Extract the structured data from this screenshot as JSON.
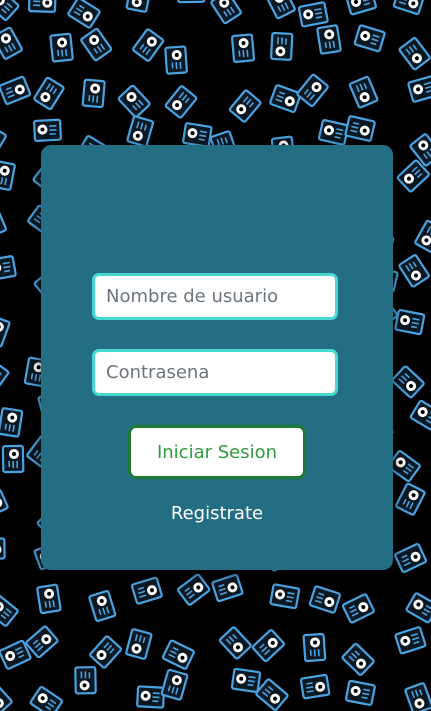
{
  "background": {
    "color": "#000000",
    "icon_color": "#4aa3e0",
    "icon_name": "id-card-eye-icon"
  },
  "login": {
    "title": "Iniciar Sesion",
    "username_placeholder": "Nombre de usuario",
    "password_placeholder": "Contrasena",
    "submit_label": "Iniciar Sesion",
    "register_label": "Registrate",
    "card_color": "#236e82",
    "field_border_color": "#45d9d0",
    "submit_text_color": "#2e9c3d",
    "submit_border_color": "#1f7a36"
  }
}
